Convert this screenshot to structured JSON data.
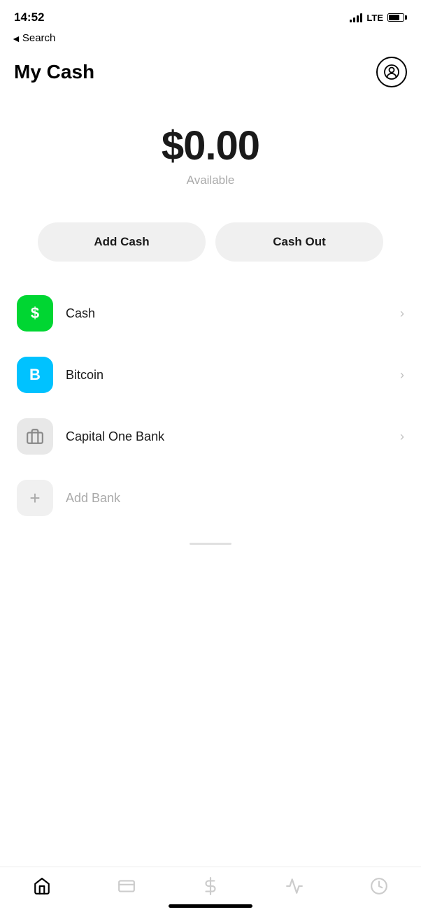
{
  "statusBar": {
    "time": "14:52",
    "lteLabel": "LTE"
  },
  "backNav": {
    "chevron": "◄",
    "label": "Search"
  },
  "header": {
    "title": "My Cash",
    "avatarLabel": "profile"
  },
  "balance": {
    "amount": "$0.00",
    "label": "Available"
  },
  "actions": {
    "addCash": "Add Cash",
    "cashOut": "Cash Out"
  },
  "listItems": [
    {
      "id": "cash",
      "name": "Cash",
      "iconText": "$",
      "iconType": "green",
      "hasChevron": true
    },
    {
      "id": "bitcoin",
      "name": "Bitcoin",
      "iconText": "B",
      "iconType": "cyan",
      "hasChevron": true
    },
    {
      "id": "capital-one",
      "name": "Capital One Bank",
      "iconText": "▬",
      "iconType": "gray",
      "hasChevron": true
    },
    {
      "id": "add-bank",
      "name": "Add Bank",
      "iconText": "+",
      "iconType": "light-gray",
      "hasChevron": false,
      "muted": true
    }
  ],
  "bottomNav": [
    {
      "id": "home",
      "icon": "home",
      "active": true
    },
    {
      "id": "card",
      "icon": "card",
      "active": false
    },
    {
      "id": "dollar",
      "icon": "dollar",
      "active": false
    },
    {
      "id": "activity",
      "icon": "activity",
      "active": false
    },
    {
      "id": "clock",
      "icon": "clock",
      "active": false
    }
  ]
}
